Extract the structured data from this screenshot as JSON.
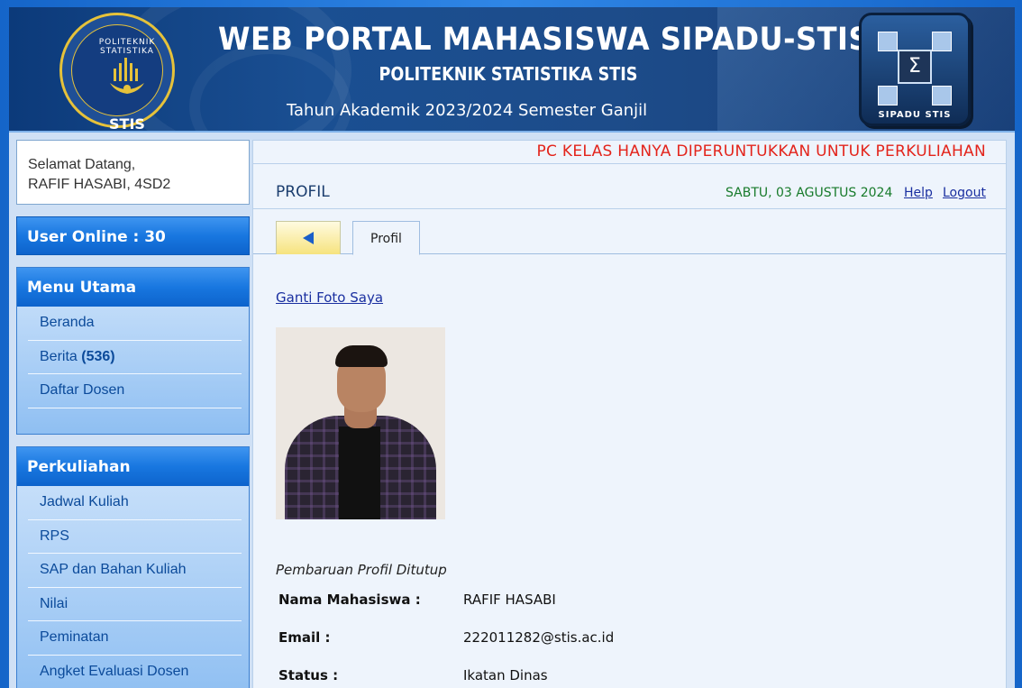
{
  "banner": {
    "logo_ring_text": "POLITEKNIK STATISTIKA",
    "logo_short": "STIS",
    "title": "WEB PORTAL MAHASISWA SIPADU-STIS",
    "subtitle": "POLITEKNIK STATISTIKA STIS",
    "academic_year": "Tahun Akademik 2023/2024 Semester Ganjil",
    "app_logo_label": "SIPADU STIS"
  },
  "sidebar": {
    "welcome_line1": "Selamat Datang,",
    "welcome_line2": "RAFIF HASABI, 4SD2",
    "user_online": "User Online : 30",
    "menu_utama": {
      "title": "Menu Utama",
      "items": [
        {
          "label": "Beranda"
        },
        {
          "label": "Berita",
          "count": "(536)"
        },
        {
          "label": "Daftar Dosen"
        }
      ]
    },
    "perkuliahan": {
      "title": "Perkuliahan",
      "items": [
        {
          "label": "Jadwal Kuliah"
        },
        {
          "label": "RPS"
        },
        {
          "label": "SAP dan Bahan Kuliah"
        },
        {
          "label": "Nilai"
        },
        {
          "label": "Peminatan"
        },
        {
          "label": "Angket Evaluasi Dosen"
        }
      ]
    }
  },
  "main": {
    "notice": "PC KELAS HANYA DIPERUNTUKKAN UNTUK PERKULIAHAN",
    "page_title": "PROFIL",
    "date": "SABTU, 03 AGUSTUS 2024",
    "help_link": "Help",
    "logout_link": "Logout",
    "tab_profil": "Profil",
    "change_photo_link": "Ganti Foto Saya",
    "update_status": "Pembaruan Profil Ditutup",
    "fields": [
      {
        "label": "Nama Mahasiswa :",
        "value": "RAFIF HASABI"
      },
      {
        "label": "Email :",
        "value": "222011282@stis.ac.id"
      },
      {
        "label": "Status :",
        "value": "Ikatan Dinas"
      }
    ]
  },
  "colors": {
    "notice": "#e3241b",
    "date": "#177a2a",
    "link": "#1a2fa0",
    "menu_head": "#1877e0"
  }
}
